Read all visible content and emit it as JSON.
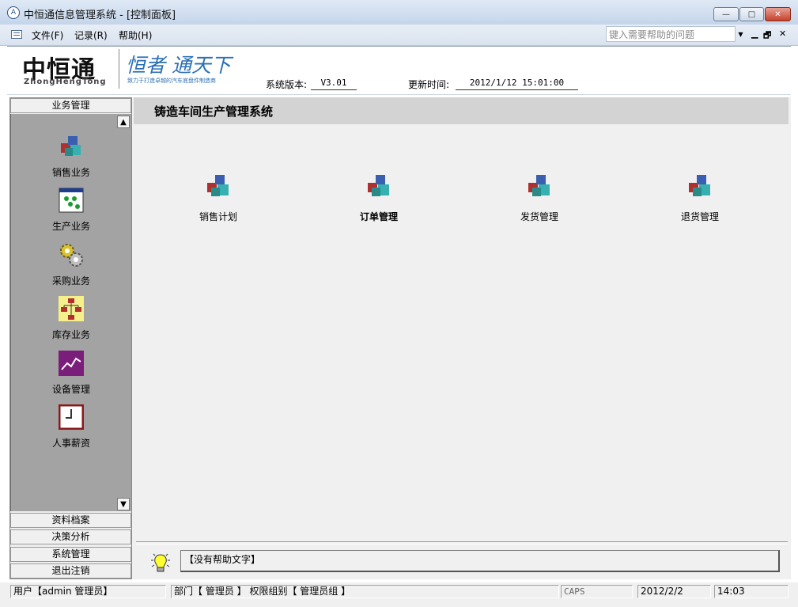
{
  "window": {
    "title": "中恒通信息管理系统 - [控制面板]",
    "controls": {
      "minimize": "—",
      "maximize": "□",
      "close": "✕"
    }
  },
  "menu": {
    "items": [
      "文件(F)",
      "记录(R)",
      "帮助(H)"
    ],
    "help_placeholder": "键入需要帮助的问题",
    "mdi_controls": [
      "▁",
      "🗗",
      "✕"
    ]
  },
  "header": {
    "logo_cn": "中恒通",
    "logo_en": "ZhongHengTong",
    "slogan": "恒者 通天下",
    "slogan_sub": "致力于打造卓越的汽车底盘件制造商",
    "version_label": "系统版本:",
    "version_value": "V3.01",
    "update_label": "更新时间:",
    "update_value": "2012/1/12 15:01:00"
  },
  "sidebar": {
    "top_tab": "业务管理",
    "items": [
      {
        "label": "销售业务",
        "icon": "cubes-icon"
      },
      {
        "label": "生产业务",
        "icon": "window-dots-icon"
      },
      {
        "label": "采购业务",
        "icon": "gears-icon"
      },
      {
        "label": "库存业务",
        "icon": "org-chart-icon"
      },
      {
        "label": "设备管理",
        "icon": "trend-chart-icon"
      },
      {
        "label": "人事薪资",
        "icon": "clock-icon"
      }
    ],
    "bottom_tabs": [
      "资料档案",
      "决策分析",
      "系统管理",
      "退出注销"
    ]
  },
  "main": {
    "title": "铸造车间生产管理系统",
    "items": [
      {
        "label": "销售计划",
        "bold": false
      },
      {
        "label": "订单管理",
        "bold": true
      },
      {
        "label": "发货管理",
        "bold": false
      },
      {
        "label": "退货管理",
        "bold": false
      }
    ],
    "help_text": "【没有帮助文字】"
  },
  "status": {
    "user": "用户【admin 管理员】",
    "dept": "部门【 管理员 】 权限组别【 管理员组 】",
    "caps": "CAPS",
    "date": "2012/2/2",
    "time": "14:03"
  },
  "colors": {
    "accent_blue": "#2a6fb5",
    "sidebar_panel": "#a3a3a3",
    "main_bg": "#f0f0f0"
  }
}
